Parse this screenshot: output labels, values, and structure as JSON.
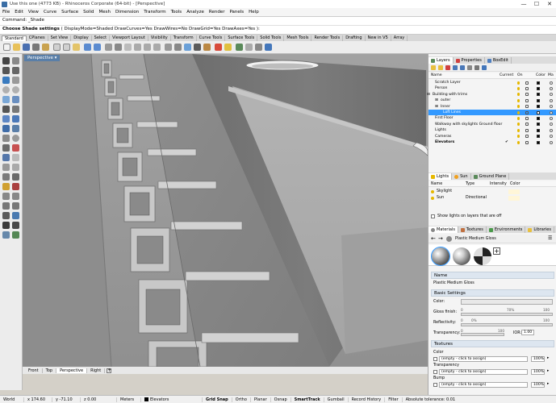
{
  "window": {
    "title": "Use this one (4773 KB) - Rhinoceros Corporate (64-bit) - [Perspective]",
    "controls": [
      "—",
      "☐",
      "✕"
    ]
  },
  "menu": [
    "File",
    "Edit",
    "View",
    "Curve",
    "Surface",
    "Solid",
    "Mesh",
    "Dimension",
    "Transform",
    "Tools",
    "Analyze",
    "Render",
    "Panels",
    "Help"
  ],
  "command": {
    "history_line": "Command: _Shade",
    "prompt_label": "Choose Shade settings",
    "prompt_options": "( DisplayMode=Shaded  DrawCurves=Yes  DrawWires=No  DrawGrid=Yes  DrawAxes=Yes ):"
  },
  "toolbar_tabs": [
    "Standard",
    "CPlanes",
    "Set View",
    "Display",
    "Select",
    "Viewport Layout",
    "Visibility",
    "Transform",
    "Curve Tools",
    "Surface Tools",
    "Solid Tools",
    "Mesh Tools",
    "Render Tools",
    "Drafting",
    "New in V5",
    "Array"
  ],
  "viewport": {
    "label": "Perspective",
    "bottom_tabs": [
      "Front",
      "Top",
      "Perspective",
      "Right"
    ]
  },
  "panel": {
    "tabs": [
      "Layers",
      "Properties",
      "BoxEdit"
    ],
    "layer_columns": {
      "name": "Name",
      "current": "Current",
      "on": "On",
      "color": "Color",
      "material": "Ma"
    },
    "layers": [
      {
        "name": "Scratch Layer",
        "indent": 1,
        "color": "#000000"
      },
      {
        "name": "Person",
        "indent": 1,
        "color": "#000000"
      },
      {
        "name": "Building with trims",
        "indent": 0,
        "color": "#000000",
        "expand": "⊟"
      },
      {
        "name": "outer",
        "indent": 2,
        "color": "#000000",
        "expand": "⊞"
      },
      {
        "name": "Inner",
        "indent": 2,
        "color": "#000000",
        "expand": "⊞"
      },
      {
        "name": "Loft Lines",
        "indent": 3,
        "color": "#ffffff",
        "selected": true
      },
      {
        "name": "First Floor",
        "indent": 1,
        "color": "#000000"
      },
      {
        "name": "Walkway with skylights Ground floor",
        "indent": 1,
        "color": "#000000"
      },
      {
        "name": "Lights",
        "indent": 1,
        "color": "#000000"
      },
      {
        "name": "Cameras",
        "indent": 1,
        "color": "#000000"
      },
      {
        "name": "Elevators",
        "indent": 1,
        "color": "#000000",
        "bold": true,
        "current": "✔"
      }
    ],
    "lights_tabs": [
      "Lights",
      "Sun",
      "Ground Plane"
    ],
    "lights_columns": {
      "name": "Name",
      "type": "Type",
      "intensity": "Intensity",
      "color": "Color"
    },
    "lights": [
      {
        "name": "Skylight",
        "type": "",
        "swatch": "#fff6d8"
      },
      {
        "name": "Sun",
        "type": "Directional",
        "swatch": "#fff6d8"
      }
    ],
    "show_lights_label": "Show lights on layers that are off",
    "material_tabs": [
      "Materials",
      "Textures",
      "Environments",
      "Libraries"
    ],
    "material_name": "Plastic Medium Gloss",
    "name_section": "Name",
    "name_value": "Plastic Medium Gloss",
    "basic_section": "Basic Settings",
    "color_label": "Color:",
    "gloss_label": "Gloss finish:",
    "gloss_value": "70%",
    "reflectivity_label": "Reflectivity:",
    "reflectivity_value": "0%",
    "transparency_label": "Transparency:",
    "ior_label": "IOR:",
    "ior_value": "1.00",
    "slider_min": "0",
    "slider_max": "100",
    "textures_section": "Textures",
    "texture_slots": [
      {
        "label": "Color",
        "value": "(empty - click to assign)",
        "percent": "100%"
      },
      {
        "label": "Transparency",
        "value": "(empty - click to assign)",
        "percent": "100%"
      },
      {
        "label": "Bump",
        "value": "(empty - click to assign)",
        "percent": "100%"
      }
    ]
  },
  "status": {
    "cplane": "World",
    "x": "x 174.60",
    "y": "y -71.10",
    "z": "z 0.00",
    "units": "Meters",
    "layer": "Elevators",
    "toggles": [
      "Grid Snap",
      "Ortho",
      "Planar",
      "Osnap",
      "SmartTrack",
      "Gumball",
      "Record History",
      "Filter"
    ],
    "toggles_on": [
      "Grid Snap",
      "SmartTrack"
    ],
    "tolerance": "Absolute tolerance: 0.01"
  },
  "colors": {
    "accent": "#3399ff",
    "viewport_bg": "#9c9c9c",
    "layer_bulb": "#e6b800"
  }
}
